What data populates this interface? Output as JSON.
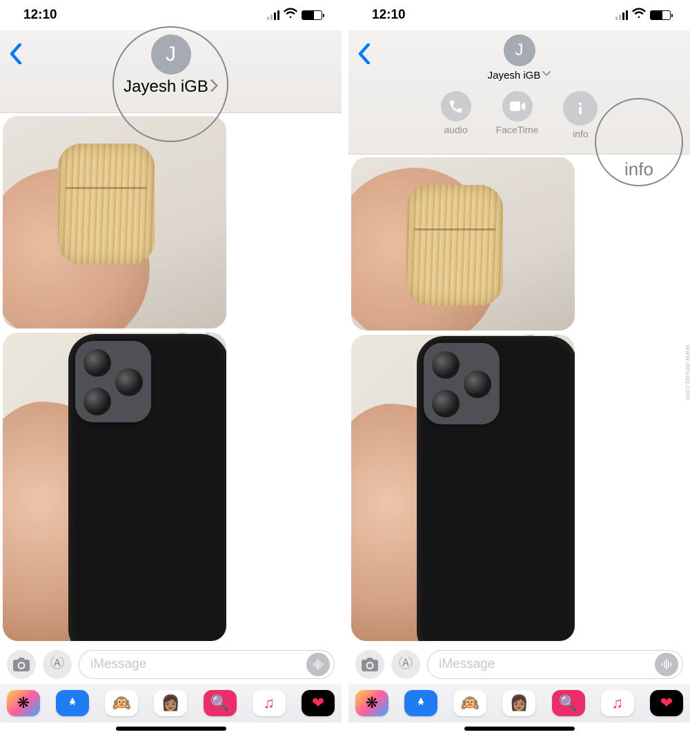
{
  "watermark": "www.deuaq.com",
  "status": {
    "time": "12:10"
  },
  "screen1": {
    "contact_name": "Jayesh iGB",
    "avatar_initial": "J"
  },
  "screen2": {
    "contact_name": "Jayesh iGB",
    "avatar_initial": "J",
    "actions": {
      "audio": "audio",
      "facetime": "FaceTime",
      "info": "info"
    },
    "highlight_label": "info"
  },
  "input": {
    "placeholder": "iMessage"
  },
  "app_drawer": {
    "items": [
      {
        "name": "photos",
        "bg": "#ffffff",
        "emoji": "✿"
      },
      {
        "name": "appstore",
        "bg": "#1f7cf2",
        "emoji": "A"
      },
      {
        "name": "memoji1",
        "bg": "#ffffff",
        "emoji": "🐵"
      },
      {
        "name": "memoji2",
        "bg": "#ffffff",
        "emoji": "👩"
      },
      {
        "name": "images",
        "bg": "#ea2e6a",
        "emoji": "⦿"
      },
      {
        "name": "music",
        "bg": "#ffffff",
        "emoji": "♪"
      },
      {
        "name": "digitaltouch",
        "bg": "#000000",
        "emoji": "❤"
      }
    ]
  }
}
